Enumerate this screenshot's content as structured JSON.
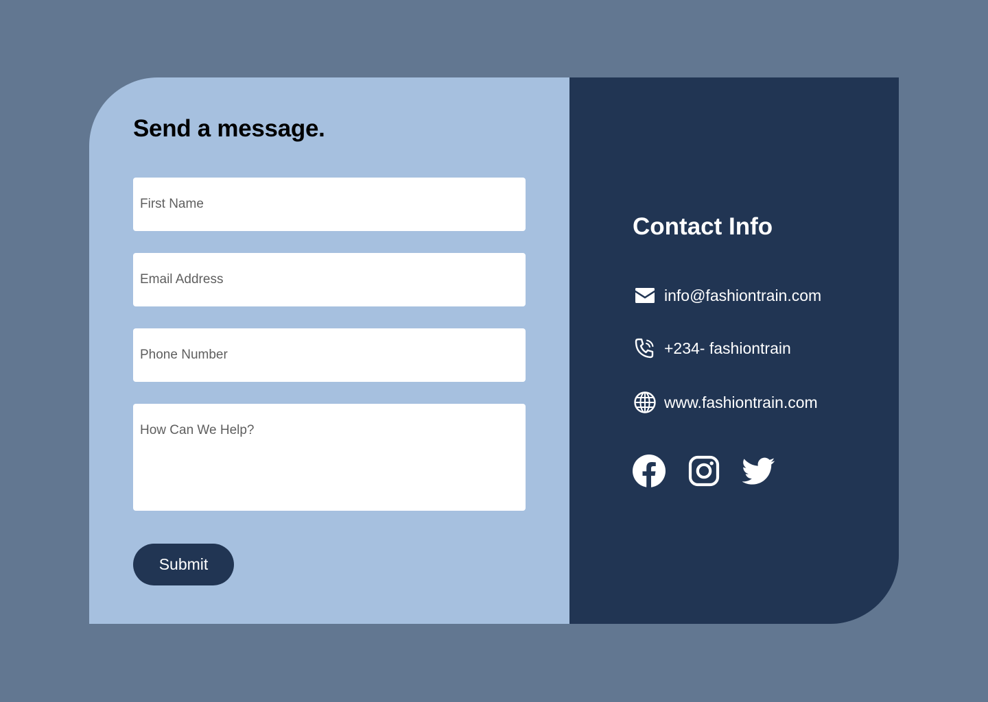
{
  "form": {
    "title": "Send a message.",
    "fields": {
      "first_name_placeholder": "First Name",
      "email_placeholder": "Email Address",
      "phone_placeholder": "Phone Number",
      "message_placeholder": "How Can We Help?"
    },
    "submit_label": "Submit"
  },
  "contact": {
    "title": "Contact Info",
    "items": [
      {
        "icon": "envelope-icon",
        "text": "info@fashiontrain.com"
      },
      {
        "icon": "phone-icon",
        "text": "+234- fashiontrain"
      },
      {
        "icon": "globe-icon",
        "text": "www.fashiontrain.com"
      }
    ],
    "social": [
      "facebook-icon",
      "instagram-icon",
      "twitter-icon"
    ]
  },
  "colors": {
    "page_background": "#627791",
    "form_panel": "#a6c0df",
    "info_panel": "#213553",
    "field_background": "#ffffff",
    "button_background": "#213553",
    "text_light": "#ffffff",
    "text_dark": "#000000"
  }
}
